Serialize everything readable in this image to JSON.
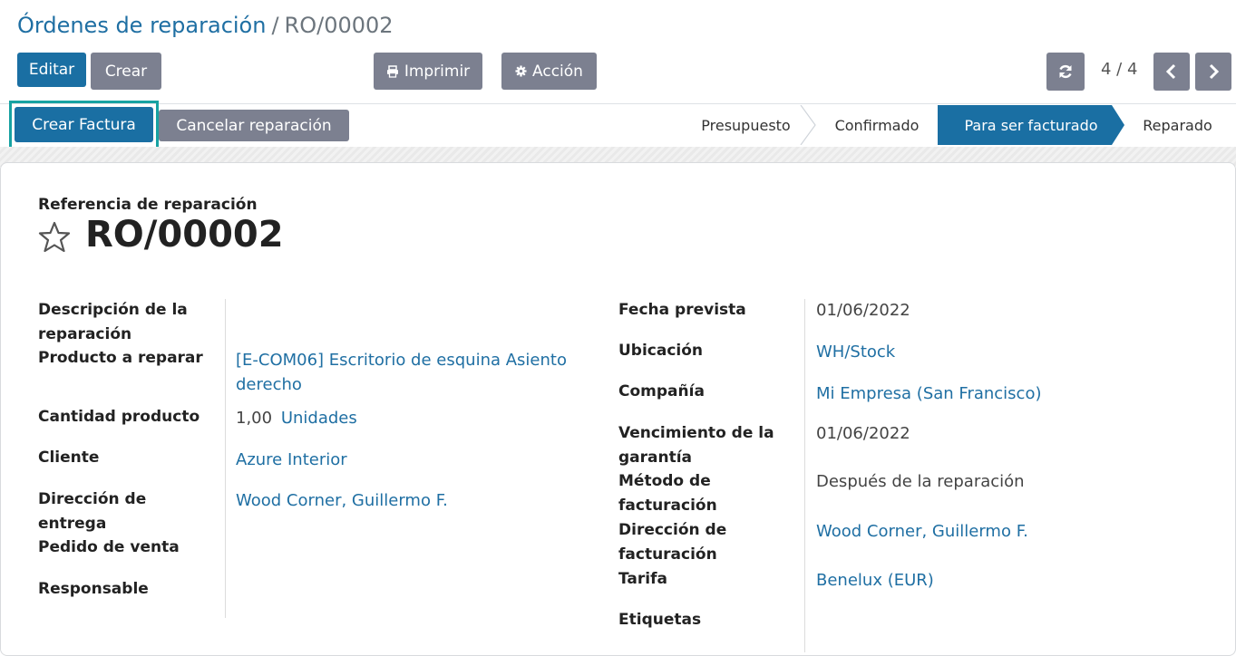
{
  "breadcrumb": {
    "parent": "Órdenes de reparación",
    "separator": "/",
    "current": "RO/00002"
  },
  "toolbar": {
    "edit_label": "Editar",
    "create_label": "Crear",
    "print_label": "Imprimir",
    "action_label": "Acción",
    "pager_text": "4 / 4"
  },
  "header_buttons": {
    "create_invoice": "Crear Factura",
    "cancel_repair": "Cancelar reparación"
  },
  "statusbar": {
    "stages": [
      "Presupuesto",
      "Confirmado",
      "Para ser facturado",
      "Reparado"
    ],
    "active": "Para ser facturado"
  },
  "record": {
    "ref_label": "Referencia de reparación",
    "ref": "RO/00002"
  },
  "left_fields": {
    "description_label": "Descripción de la reparación",
    "product_label": "Producto a reparar",
    "product_value": "[E-COM06] Escritorio de esquina Asiento derecho",
    "qty_label": "Cantidad producto",
    "qty_value": "1,00",
    "uom_value": "Unidades",
    "customer_label": "Cliente",
    "customer_value": "Azure Interior",
    "delivery_label": "Dirección de entrega",
    "delivery_value": "Wood Corner, Guillermo F.",
    "sale_order_label": "Pedido de venta",
    "responsible_label": "Responsable"
  },
  "right_fields": {
    "date_label": "Fecha prevista",
    "date_value": "01/06/2022",
    "location_label": "Ubicación",
    "location_value": "WH/Stock",
    "company_label": "Compañía",
    "company_value": "Mi Empresa (San Francisco)",
    "warranty_label": "Vencimiento de la garantía",
    "warranty_value": "01/06/2022",
    "invoice_method_label": "Método de facturación",
    "invoice_method_value": "Después de la reparación",
    "invoice_address_label": "Dirección de facturación",
    "invoice_address_value": "Wood Corner, Guillermo F.",
    "pricelist_label": "Tarifa",
    "pricelist_value": "Benelux (EUR)",
    "tags_label": "Etiquetas"
  },
  "colors": {
    "primary": "#1a6fa3",
    "secondary": "#7c8090",
    "link": "#1f6fa3",
    "highlight": "#17a2a2"
  },
  "icons": [
    "print-icon",
    "gear-icon",
    "refresh-icon",
    "chevron-left-icon",
    "chevron-right-icon",
    "star-icon"
  ]
}
